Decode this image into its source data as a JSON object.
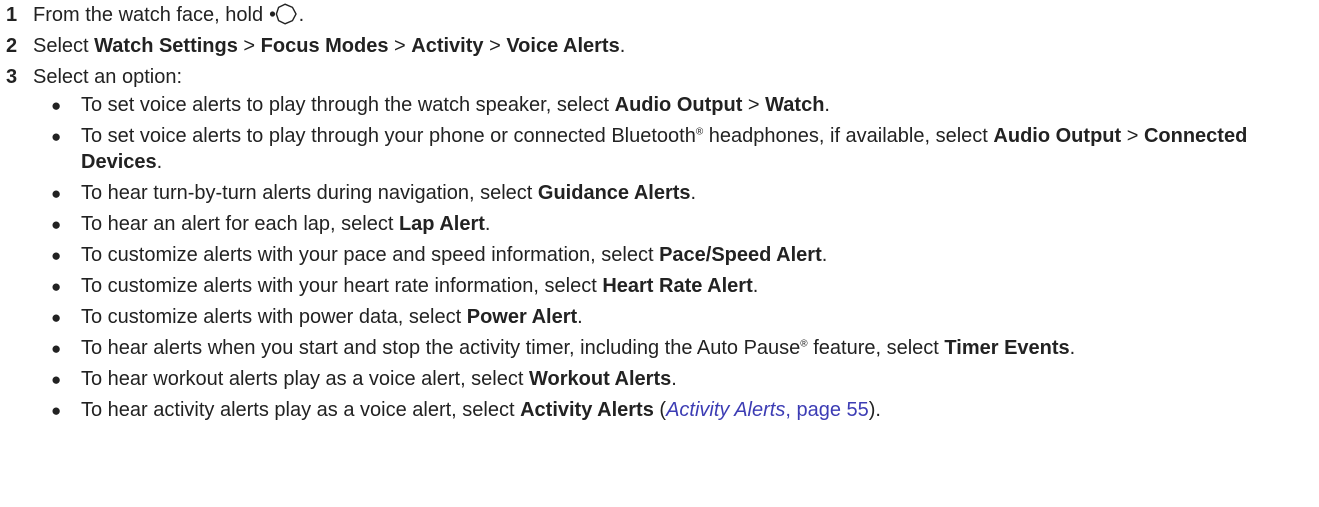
{
  "steps": [
    {
      "number": "1",
      "text_before": "From the watch face, hold ",
      "icon": "watch-button-icon",
      "text_after": "."
    },
    {
      "number": "2",
      "parts": [
        {
          "t": "Select ",
          "bold": false
        },
        {
          "t": "Watch Settings",
          "bold": true
        },
        {
          "t": " > ",
          "bold": false
        },
        {
          "t": "Focus Modes",
          "bold": true
        },
        {
          "t": " > ",
          "bold": false
        },
        {
          "t": "Activity",
          "bold": true
        },
        {
          "t": " > ",
          "bold": false
        },
        {
          "t": "Voice Alerts",
          "bold": true
        },
        {
          "t": ".",
          "bold": false
        }
      ]
    },
    {
      "number": "3",
      "text": "Select an option:"
    }
  ],
  "options": [
    [
      {
        "t": "To set voice alerts to play through the watch speaker, select "
      },
      {
        "t": "Audio Output",
        "bold": true
      },
      {
        "t": " > "
      },
      {
        "t": "Watch",
        "bold": true
      },
      {
        "t": "."
      }
    ],
    [
      {
        "t": "To set voice alerts to play through your phone or connected Bluetooth"
      },
      {
        "t": "®",
        "reg": true
      },
      {
        "t": " headphones, if available, select "
      },
      {
        "t": "Audio Output",
        "bold": true
      },
      {
        "t": " > "
      },
      {
        "t": "Connected Devices",
        "bold": true
      },
      {
        "t": "."
      }
    ],
    [
      {
        "t": "To hear turn-by-turn alerts during navigation, select "
      },
      {
        "t": "Guidance Alerts",
        "bold": true
      },
      {
        "t": "."
      }
    ],
    [
      {
        "t": "To hear an alert for each lap, select "
      },
      {
        "t": "Lap Alert",
        "bold": true
      },
      {
        "t": "."
      }
    ],
    [
      {
        "t": "To customize alerts with your pace and speed information, select "
      },
      {
        "t": "Pace/Speed Alert",
        "bold": true
      },
      {
        "t": "."
      }
    ],
    [
      {
        "t": "To customize alerts with your heart rate information, select "
      },
      {
        "t": "Heart Rate Alert",
        "bold": true
      },
      {
        "t": "."
      }
    ],
    [
      {
        "t": "To customize alerts with power data, select "
      },
      {
        "t": "Power Alert",
        "bold": true
      },
      {
        "t": "."
      }
    ],
    [
      {
        "t": "To hear alerts when you start and stop the activity timer, including the Auto Pause"
      },
      {
        "t": "®",
        "reg": true
      },
      {
        "t": " feature, select "
      },
      {
        "t": "Timer Events",
        "bold": true
      },
      {
        "t": "."
      }
    ],
    [
      {
        "t": "To hear workout alerts play as a voice alert, select "
      },
      {
        "t": "Workout Alerts",
        "bold": true
      },
      {
        "t": "."
      }
    ],
    [
      {
        "t": "To hear activity alerts play as a voice alert, select "
      },
      {
        "t": "Activity Alerts",
        "bold": true
      },
      {
        "t": " ("
      },
      {
        "t": "Activity Alerts",
        "link": true
      },
      {
        "t": ", page 55",
        "linkpage": true
      },
      {
        "t": ")."
      }
    ]
  ],
  "colors": {
    "text": "#222222",
    "link": "#3c3cb4"
  }
}
